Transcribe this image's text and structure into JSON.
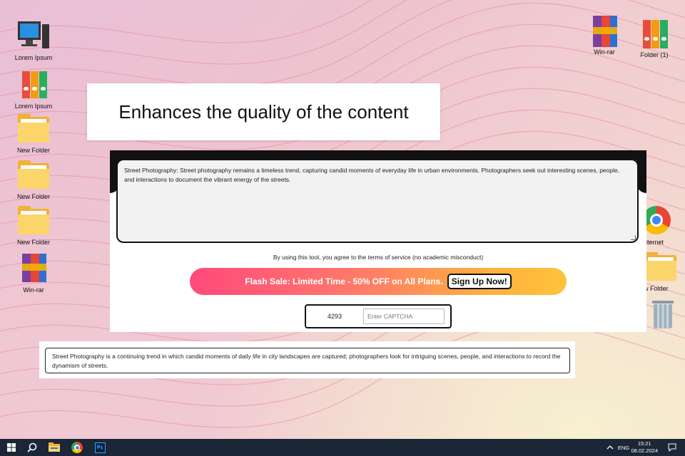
{
  "desktop": {
    "icons_left": [
      {
        "label": "Lorem Ipsum",
        "icon": "computer-icon"
      },
      {
        "label": "Lorem Ipsum",
        "icon": "binders-icon"
      },
      {
        "label": "New Folder",
        "icon": "folder-icon"
      },
      {
        "label": "New Folder",
        "icon": "folder-icon"
      },
      {
        "label": "New Folder",
        "icon": "folder-icon"
      },
      {
        "label": "Win-rar",
        "icon": "winrar-icon"
      }
    ],
    "icons_right": [
      {
        "label": "Win-rar",
        "icon": "winrar-icon"
      },
      {
        "label": "Folder (1)",
        "icon": "binders-icon"
      },
      {
        "label": "nternet",
        "icon": "chrome-icon"
      },
      {
        "label": "w Folder",
        "icon": "folder-icon"
      },
      {
        "label": "",
        "icon": "recycle-bin-icon"
      }
    ]
  },
  "heading": "Enhances the quality of the content",
  "tool": {
    "input_text": "Street Photography: Street photography remains a timeless trend, capturing candid moments of everyday life in urban environments. Photographers seek out interesting scenes, people, and interactions to document the vibrant energy of the streets.",
    "terms": "By using this tool, you agree to the terms of service (no academic misconduct)",
    "promo_text": "Flash Sale: Limited Time - 50% OFF on All Plans.",
    "promo_cta": "Sign Up Now!",
    "captcha_code": "4293",
    "captcha_placeholder": "Enter CAPTCHA"
  },
  "output_text": "Street Photography is a continuing trend in which candid moments of daily life in city landscapes are captured; photographers look for intriguing scenes, people, and interactions to record the dynamism of streets.",
  "taskbar": {
    "items": [
      "start-icon",
      "search-icon",
      "file-explorer-icon",
      "chrome-icon",
      "photoshop-icon"
    ],
    "photoshop_label": "Ps",
    "language": "ENG",
    "time": "15:21",
    "date": "08.02.2024"
  },
  "colors": {
    "promo_start": "#ff4a7b",
    "promo_end": "#ffc23a",
    "taskbar": "#1b2636"
  }
}
